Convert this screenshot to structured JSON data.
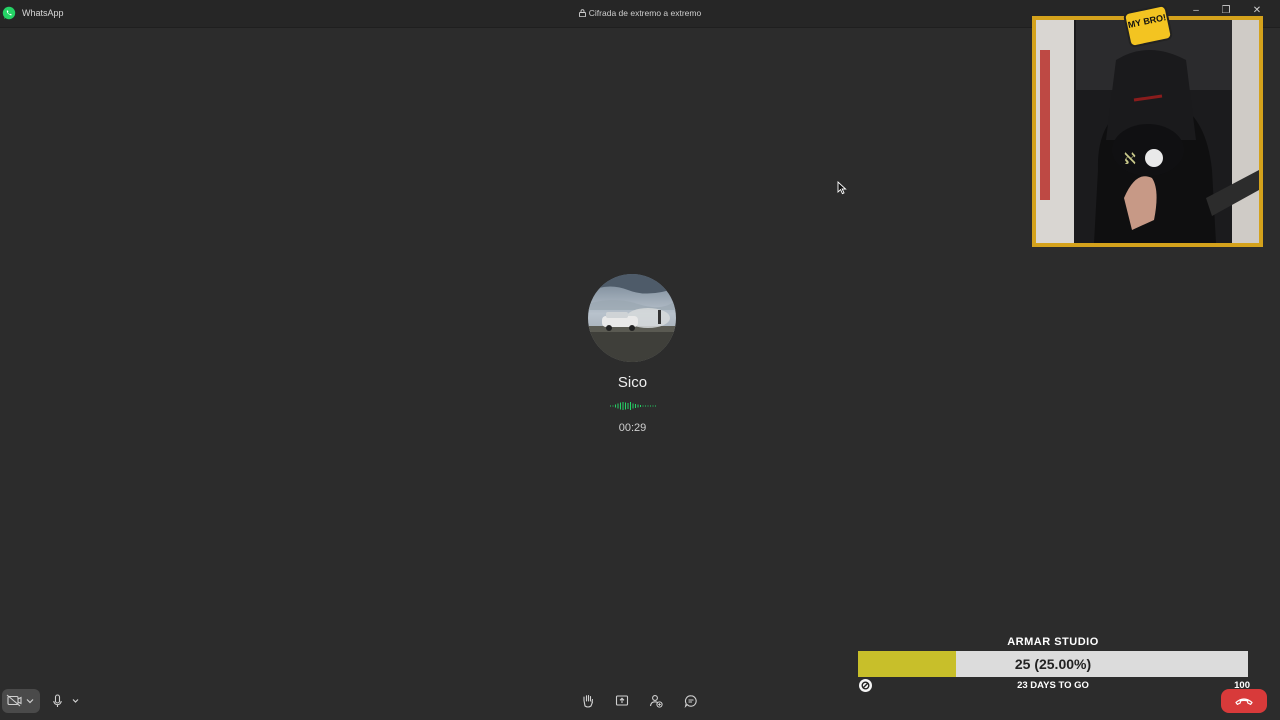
{
  "titlebar": {
    "app_name": "WhatsApp",
    "encryption_label": "Cifrada de extremo a extremo",
    "minimize_glyph": "–",
    "maximize_glyph": "❐",
    "close_glyph": "✕"
  },
  "call": {
    "contact_name": "Sico",
    "duration": "00:29"
  },
  "overlay": {
    "badge_text": "MY BRO!",
    "goal": {
      "title": "ARMAR STUDIO",
      "current_text": "25 (25.00%)",
      "progress_fraction": 0.25,
      "subtitle": "23 DAYS TO GO",
      "max_label": "100"
    }
  },
  "controls": {
    "icons": [
      "video-off-icon",
      "chevron-down-icon",
      "microphone-icon",
      "raise-hand-icon",
      "share-screen-icon",
      "add-participant-icon",
      "chat-icon",
      "end-call-icon"
    ]
  },
  "colors": {
    "background": "#2c2c2c",
    "accent_green": "#25d366",
    "hangup_red": "#d83a3a",
    "goal_fill": "#c8bf2a",
    "cam_border": "#d4a21c"
  }
}
